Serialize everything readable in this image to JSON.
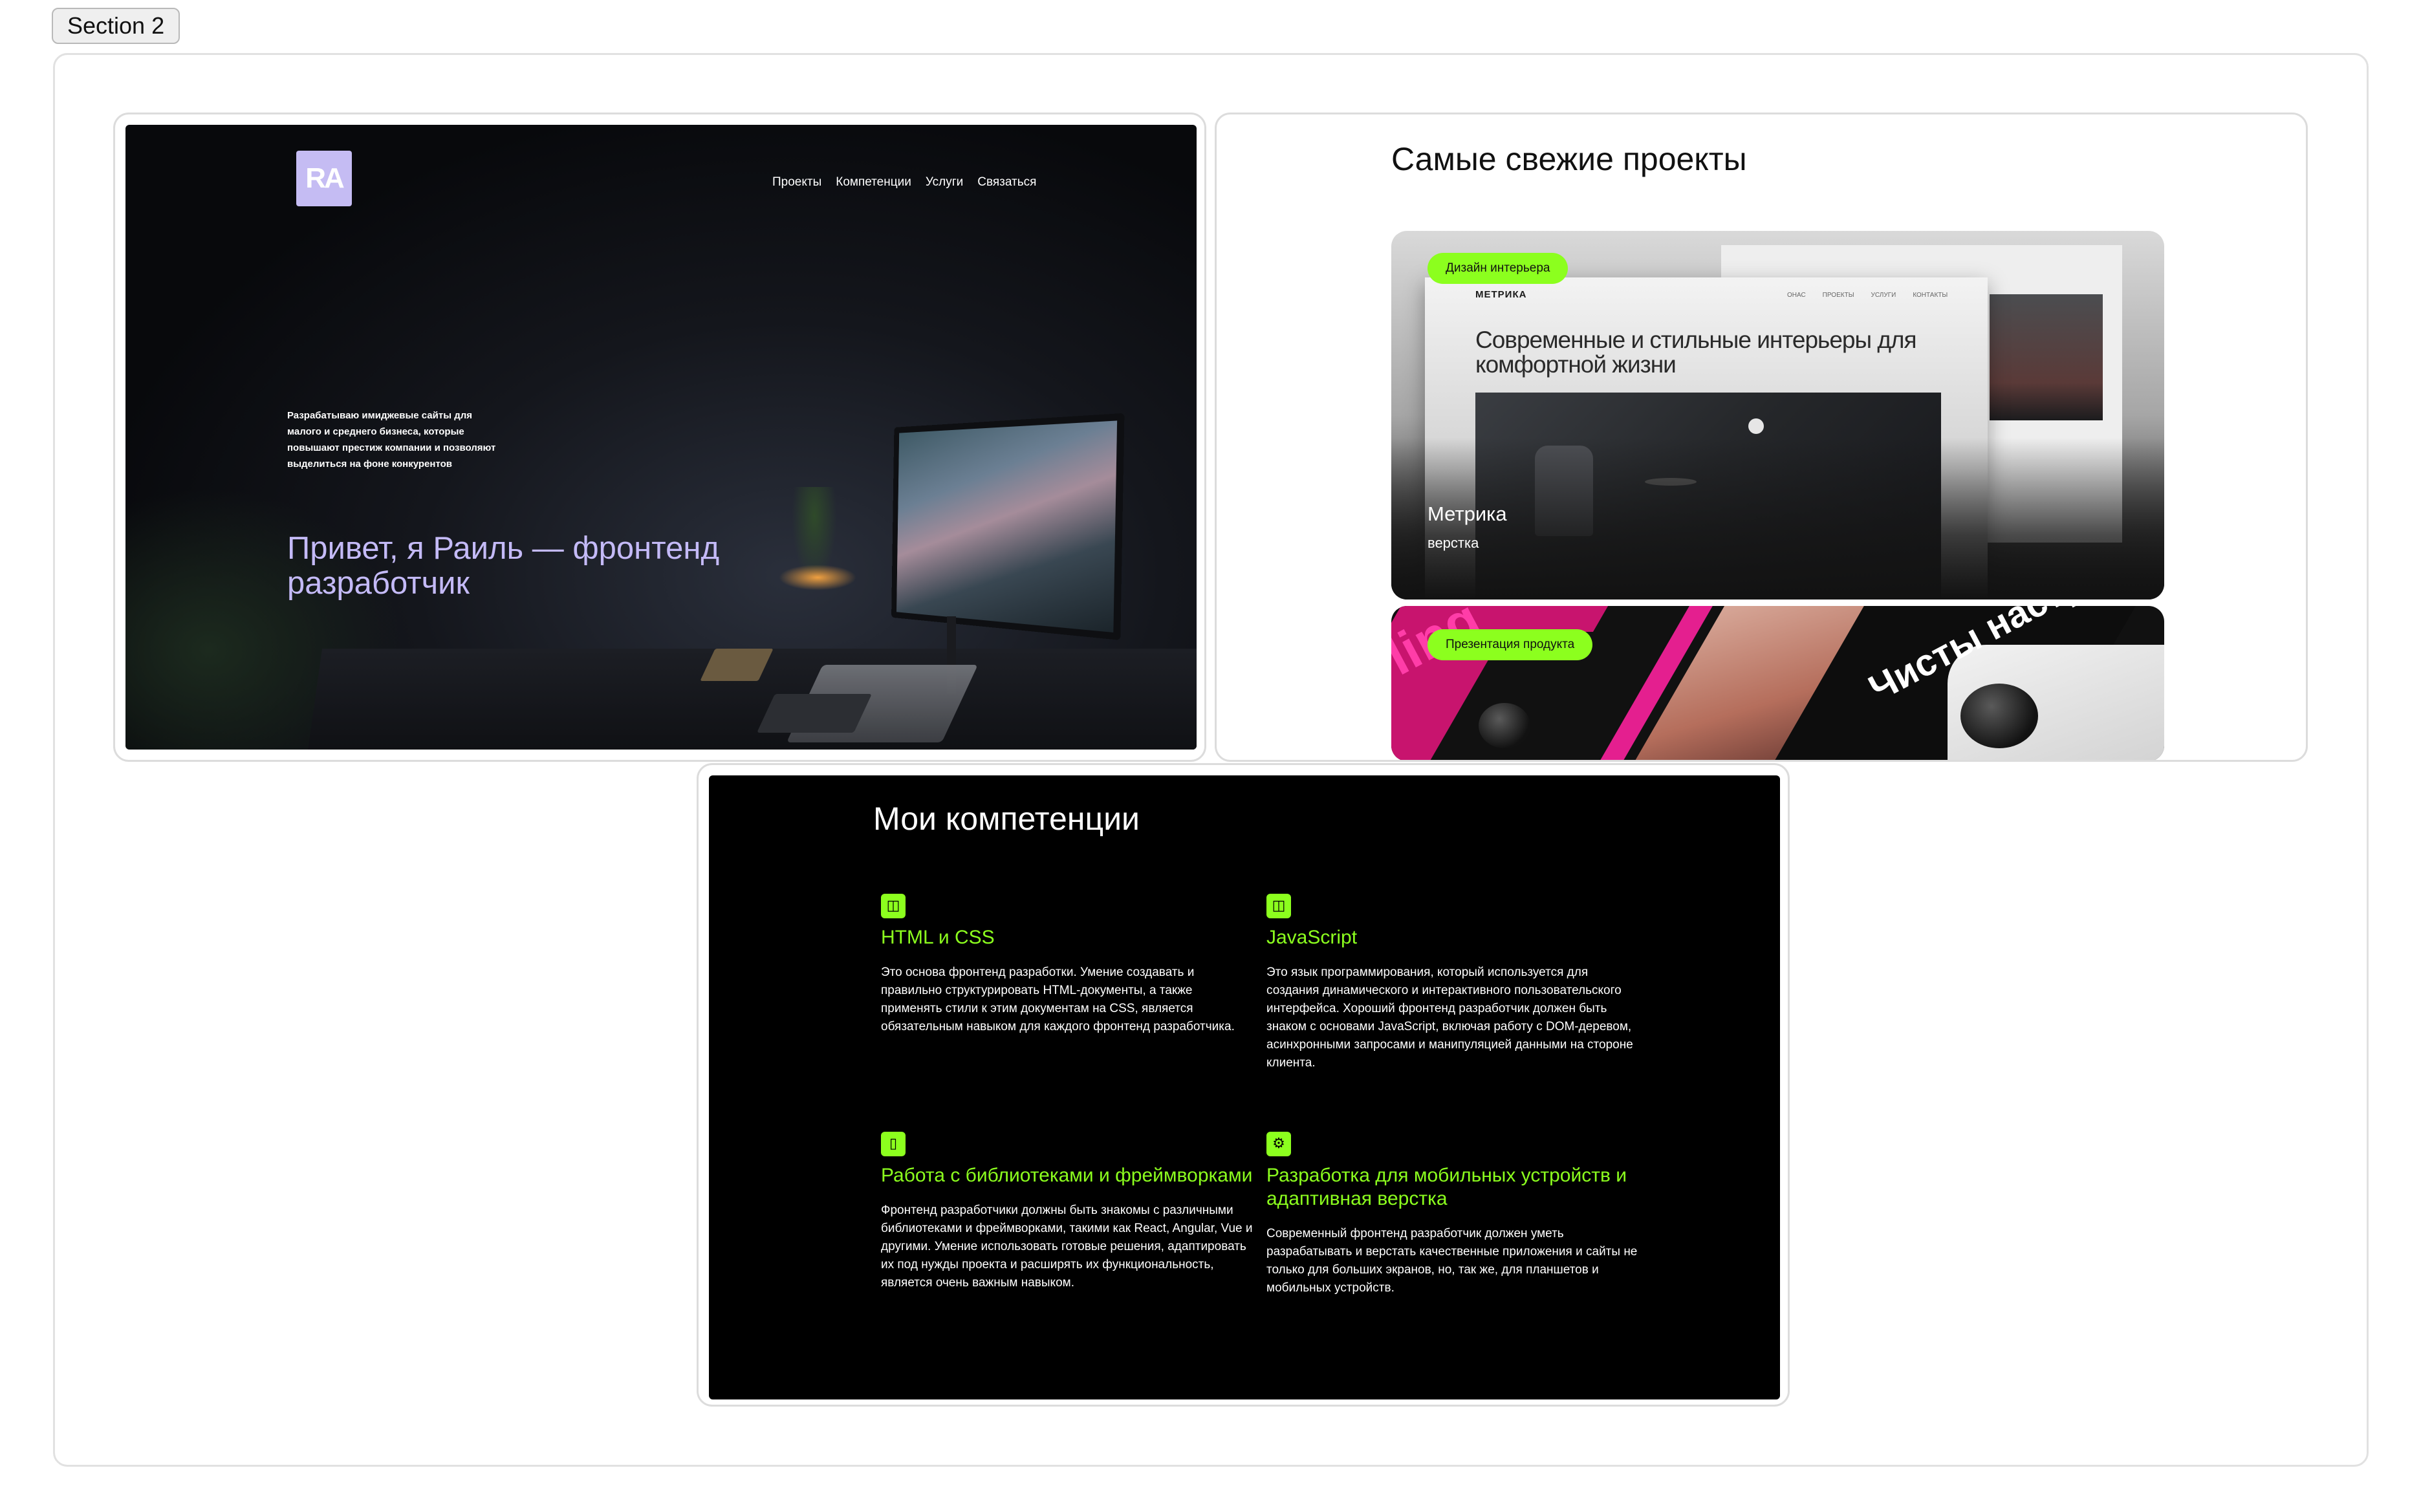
{
  "section_label": "Section 2",
  "hero": {
    "logo_text": "RA",
    "nav": [
      "Проекты",
      "Компетенции",
      "Услуги",
      "Связаться"
    ],
    "description": "Разрабатываю имиджевые сайты для малого и среднего бизнеса, которые повышают престиж компании и позволяют выделиться на фоне конкурентов",
    "title": "Привет, я Раиль — фронтенд разработчик",
    "accent_color": "#c4baf7"
  },
  "projects": {
    "heading": "Самые свежие проекты",
    "accent_color": "#8cff1e",
    "items": [
      {
        "tag": "Дизайн интерьера",
        "title": "Метрика",
        "subtitle": "верстка",
        "preview": {
          "logo": "МЕТРИКА",
          "nav": [
            "ОНАС",
            "ПРОЕКТЫ",
            "УСЛУГИ",
            "КОНТАКТЫ"
          ],
          "headline": "Современные и стильные интерьеры для комфортной жизни"
        }
      },
      {
        "tag": "Презентация продукта",
        "preview": {
          "big_text": "Чисты настро",
          "pink_text": "ling"
        }
      }
    ]
  },
  "competencies": {
    "heading": "Мои компетенции",
    "accent_color": "#8cff1e",
    "items": [
      {
        "icon": "file-icon",
        "title": "HTML и CSS",
        "text": "Это основа фронтенд разработки. Умение создавать и правильно структурировать HTML-документы, а также применять стили к этим документам на CSS, является обязательным навыком для каждого фронтенд разработчика."
      },
      {
        "icon": "file-icon",
        "title": "JavaScript",
        "text": "Это язык программирования, который используется для создания динамического и интерактивного пользовательского интерфейса. Хороший фронтенд разработчик должен быть знаком с основами JavaScript, включая работу с DOM-деревом, асинхронными запросами и манипуляцией данными на стороне клиента."
      },
      {
        "icon": "phone-icon",
        "title": "Работа с библиотеками и фреймворками",
        "text": "Фронтенд разработчики должны быть знакомы с различными библиотеками и фреймворками, такими как React, Angular, Vue и другими. Умение использовать готовые решения, адаптировать их под нужды проекта и расширять их функциональность, является очень важным навыком."
      },
      {
        "icon": "gear-icon",
        "title": "Разработка для мобильных устройств и адаптивная верстка",
        "text": "Современный фронтенд разработчик должен уметь разрабатывать и верстать качественные приложения и сайты не только для больших экранов, но, так же, для планшетов и мобильных устройств."
      }
    ]
  }
}
